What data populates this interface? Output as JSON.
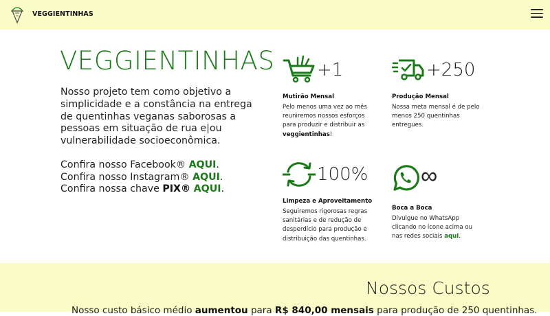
{
  "navbar": {
    "brand": "VEGGIENTINHAS"
  },
  "hero": {
    "title": "VEGGIENTINHAS",
    "description": "Nosso projeto tem como objetivo a simplicidade e a constância na entrega de quentinhas veganas saborosas a pessoas em situação de rua e|ou vulnerabilidade socioeconômica.",
    "links": [
      {
        "prefix": "Confira nosso Facebook® ",
        "link": "AQUI",
        "suffix": "."
      },
      {
        "prefix": "Confira nosso Instagram® ",
        "link": "AQUI",
        "suffix": "."
      },
      {
        "prefix": "Confira nossa chave ",
        "bold": "PIX®",
        "mid": " ",
        "link": "AQUI",
        "suffix": "."
      }
    ]
  },
  "features": [
    {
      "icon": "shopping-cart-icon",
      "stat": "+1",
      "title": "Mutirão Mensal",
      "text": "Pelo menos uma vez ao mês reuniremos nossos esforços para produzir e distribuir as ",
      "bold": "veggientinhas",
      "tail": "!"
    },
    {
      "icon": "delivery-truck-icon",
      "stat": "+250",
      "title": "Produção Mensal",
      "text": "Nossa meta mensal é de pelo menos 250 quentinhas entregues."
    },
    {
      "icon": "recycle-icon",
      "stat": "100%",
      "title": "Limpeza e Aproveitamento",
      "text": "Seguiremos rigorosas regras sanitárias e de redução de desperdício para produção e distribuição das quentinhas."
    },
    {
      "icon": "whatsapp-icon",
      "stat": "∞",
      "title": "Boca a Boca",
      "text": "Divulgue no WhatsApp clicando no ícone acima ou nas redes sociais ",
      "link": "aqui",
      "tail": "."
    }
  ],
  "costs": {
    "title": "Nossos Custos",
    "line_start": "Nosso custo básico médio ",
    "line_bold1": "aumentou",
    "line_mid": " para ",
    "line_bold2": "R$ 840,00 mensais",
    "line_end": " para produção de 250 quentinhas."
  },
  "colors": {
    "accent": "#1a7a18",
    "banner": "#fafcc8"
  }
}
